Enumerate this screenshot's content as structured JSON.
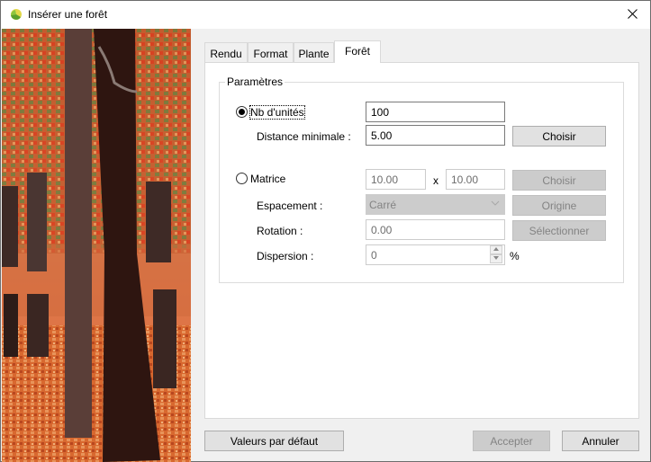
{
  "window": {
    "title": "Insérer une forêt",
    "icon": "forest-app-icon",
    "close_icon": "close-icon"
  },
  "preview_image": {
    "description": "Autumn forest with tree trunks and orange fallen leaves",
    "colors": {
      "trunk": "#3a1a10",
      "leaves_orange": "#d8602c",
      "ground": "#e07a40",
      "foliage_green": "#6f7a3a"
    }
  },
  "tabs": [
    {
      "label": "Rendu",
      "active": false
    },
    {
      "label": "Format",
      "active": false
    },
    {
      "label": "Plante",
      "active": false
    },
    {
      "label": "Forêt",
      "active": true
    }
  ],
  "parameters": {
    "group_title": "Paramètres",
    "nb_units": {
      "label": "Nb d'unités",
      "selected": true,
      "value": "100"
    },
    "min_distance": {
      "label": "Distance minimale :",
      "value": "5.00",
      "button": "Choisir"
    },
    "matrix": {
      "label": "Matrice",
      "selected": false,
      "value_x": "10.00",
      "separator": "x",
      "value_y": "10.00",
      "button": "Choisir"
    },
    "spacing": {
      "label": "Espacement :",
      "value": "Carré",
      "button": "Origine"
    },
    "rotation": {
      "label": "Rotation :",
      "value": "0.00",
      "button": "Sélectionner"
    },
    "dispersion": {
      "label": "Dispersion :",
      "value": "0",
      "unit": "%"
    }
  },
  "footer": {
    "defaults_button": "Valeurs par défaut",
    "accept_button": "Accepter",
    "cancel_button": "Annuler"
  }
}
